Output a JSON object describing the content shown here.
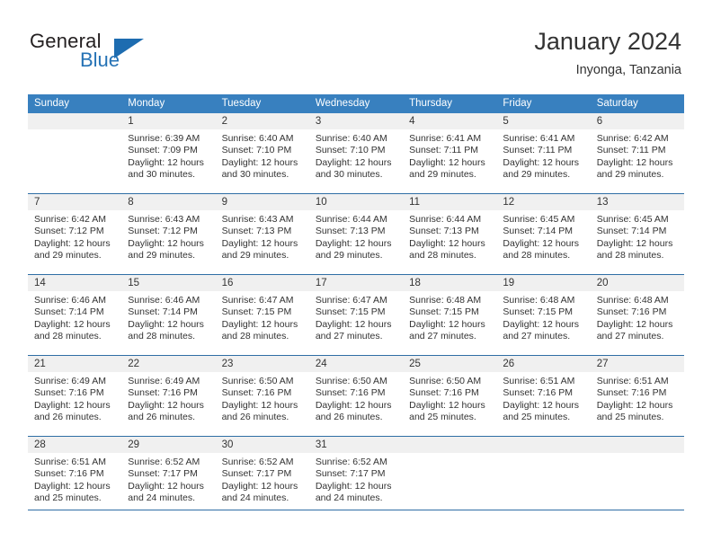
{
  "brand": {
    "name_part1": "General",
    "name_part2": "Blue",
    "triangle_color": "#1d6cb0",
    "blue_color": "#2572b5"
  },
  "header": {
    "title": "January 2024",
    "subtitle": "Inyonga, Tanzania"
  },
  "theme": {
    "header_bar_color": "#3880bf",
    "row_divider_color": "#2f6ea5",
    "day_band_color": "#f0f0f0",
    "text_color": "#333333"
  },
  "weekdays": [
    "Sunday",
    "Monday",
    "Tuesday",
    "Wednesday",
    "Thursday",
    "Friday",
    "Saturday"
  ],
  "weeks": [
    [
      {
        "day": "",
        "sunrise": "",
        "sunset": "",
        "daylight_line1": "",
        "daylight_line2": ""
      },
      {
        "day": "1",
        "sunrise": "Sunrise: 6:39 AM",
        "sunset": "Sunset: 7:09 PM",
        "daylight_line1": "Daylight: 12 hours",
        "daylight_line2": "and 30 minutes."
      },
      {
        "day": "2",
        "sunrise": "Sunrise: 6:40 AM",
        "sunset": "Sunset: 7:10 PM",
        "daylight_line1": "Daylight: 12 hours",
        "daylight_line2": "and 30 minutes."
      },
      {
        "day": "3",
        "sunrise": "Sunrise: 6:40 AM",
        "sunset": "Sunset: 7:10 PM",
        "daylight_line1": "Daylight: 12 hours",
        "daylight_line2": "and 30 minutes."
      },
      {
        "day": "4",
        "sunrise": "Sunrise: 6:41 AM",
        "sunset": "Sunset: 7:11 PM",
        "daylight_line1": "Daylight: 12 hours",
        "daylight_line2": "and 29 minutes."
      },
      {
        "day": "5",
        "sunrise": "Sunrise: 6:41 AM",
        "sunset": "Sunset: 7:11 PM",
        "daylight_line1": "Daylight: 12 hours",
        "daylight_line2": "and 29 minutes."
      },
      {
        "day": "6",
        "sunrise": "Sunrise: 6:42 AM",
        "sunset": "Sunset: 7:11 PM",
        "daylight_line1": "Daylight: 12 hours",
        "daylight_line2": "and 29 minutes."
      }
    ],
    [
      {
        "day": "7",
        "sunrise": "Sunrise: 6:42 AM",
        "sunset": "Sunset: 7:12 PM",
        "daylight_line1": "Daylight: 12 hours",
        "daylight_line2": "and 29 minutes."
      },
      {
        "day": "8",
        "sunrise": "Sunrise: 6:43 AM",
        "sunset": "Sunset: 7:12 PM",
        "daylight_line1": "Daylight: 12 hours",
        "daylight_line2": "and 29 minutes."
      },
      {
        "day": "9",
        "sunrise": "Sunrise: 6:43 AM",
        "sunset": "Sunset: 7:13 PM",
        "daylight_line1": "Daylight: 12 hours",
        "daylight_line2": "and 29 minutes."
      },
      {
        "day": "10",
        "sunrise": "Sunrise: 6:44 AM",
        "sunset": "Sunset: 7:13 PM",
        "daylight_line1": "Daylight: 12 hours",
        "daylight_line2": "and 29 minutes."
      },
      {
        "day": "11",
        "sunrise": "Sunrise: 6:44 AM",
        "sunset": "Sunset: 7:13 PM",
        "daylight_line1": "Daylight: 12 hours",
        "daylight_line2": "and 28 minutes."
      },
      {
        "day": "12",
        "sunrise": "Sunrise: 6:45 AM",
        "sunset": "Sunset: 7:14 PM",
        "daylight_line1": "Daylight: 12 hours",
        "daylight_line2": "and 28 minutes."
      },
      {
        "day": "13",
        "sunrise": "Sunrise: 6:45 AM",
        "sunset": "Sunset: 7:14 PM",
        "daylight_line1": "Daylight: 12 hours",
        "daylight_line2": "and 28 minutes."
      }
    ],
    [
      {
        "day": "14",
        "sunrise": "Sunrise: 6:46 AM",
        "sunset": "Sunset: 7:14 PM",
        "daylight_line1": "Daylight: 12 hours",
        "daylight_line2": "and 28 minutes."
      },
      {
        "day": "15",
        "sunrise": "Sunrise: 6:46 AM",
        "sunset": "Sunset: 7:14 PM",
        "daylight_line1": "Daylight: 12 hours",
        "daylight_line2": "and 28 minutes."
      },
      {
        "day": "16",
        "sunrise": "Sunrise: 6:47 AM",
        "sunset": "Sunset: 7:15 PM",
        "daylight_line1": "Daylight: 12 hours",
        "daylight_line2": "and 28 minutes."
      },
      {
        "day": "17",
        "sunrise": "Sunrise: 6:47 AM",
        "sunset": "Sunset: 7:15 PM",
        "daylight_line1": "Daylight: 12 hours",
        "daylight_line2": "and 27 minutes."
      },
      {
        "day": "18",
        "sunrise": "Sunrise: 6:48 AM",
        "sunset": "Sunset: 7:15 PM",
        "daylight_line1": "Daylight: 12 hours",
        "daylight_line2": "and 27 minutes."
      },
      {
        "day": "19",
        "sunrise": "Sunrise: 6:48 AM",
        "sunset": "Sunset: 7:15 PM",
        "daylight_line1": "Daylight: 12 hours",
        "daylight_line2": "and 27 minutes."
      },
      {
        "day": "20",
        "sunrise": "Sunrise: 6:48 AM",
        "sunset": "Sunset: 7:16 PM",
        "daylight_line1": "Daylight: 12 hours",
        "daylight_line2": "and 27 minutes."
      }
    ],
    [
      {
        "day": "21",
        "sunrise": "Sunrise: 6:49 AM",
        "sunset": "Sunset: 7:16 PM",
        "daylight_line1": "Daylight: 12 hours",
        "daylight_line2": "and 26 minutes."
      },
      {
        "day": "22",
        "sunrise": "Sunrise: 6:49 AM",
        "sunset": "Sunset: 7:16 PM",
        "daylight_line1": "Daylight: 12 hours",
        "daylight_line2": "and 26 minutes."
      },
      {
        "day": "23",
        "sunrise": "Sunrise: 6:50 AM",
        "sunset": "Sunset: 7:16 PM",
        "daylight_line1": "Daylight: 12 hours",
        "daylight_line2": "and 26 minutes."
      },
      {
        "day": "24",
        "sunrise": "Sunrise: 6:50 AM",
        "sunset": "Sunset: 7:16 PM",
        "daylight_line1": "Daylight: 12 hours",
        "daylight_line2": "and 26 minutes."
      },
      {
        "day": "25",
        "sunrise": "Sunrise: 6:50 AM",
        "sunset": "Sunset: 7:16 PM",
        "daylight_line1": "Daylight: 12 hours",
        "daylight_line2": "and 25 minutes."
      },
      {
        "day": "26",
        "sunrise": "Sunrise: 6:51 AM",
        "sunset": "Sunset: 7:16 PM",
        "daylight_line1": "Daylight: 12 hours",
        "daylight_line2": "and 25 minutes."
      },
      {
        "day": "27",
        "sunrise": "Sunrise: 6:51 AM",
        "sunset": "Sunset: 7:16 PM",
        "daylight_line1": "Daylight: 12 hours",
        "daylight_line2": "and 25 minutes."
      }
    ],
    [
      {
        "day": "28",
        "sunrise": "Sunrise: 6:51 AM",
        "sunset": "Sunset: 7:16 PM",
        "daylight_line1": "Daylight: 12 hours",
        "daylight_line2": "and 25 minutes."
      },
      {
        "day": "29",
        "sunrise": "Sunrise: 6:52 AM",
        "sunset": "Sunset: 7:17 PM",
        "daylight_line1": "Daylight: 12 hours",
        "daylight_line2": "and 24 minutes."
      },
      {
        "day": "30",
        "sunrise": "Sunrise: 6:52 AM",
        "sunset": "Sunset: 7:17 PM",
        "daylight_line1": "Daylight: 12 hours",
        "daylight_line2": "and 24 minutes."
      },
      {
        "day": "31",
        "sunrise": "Sunrise: 6:52 AM",
        "sunset": "Sunset: 7:17 PM",
        "daylight_line1": "Daylight: 12 hours",
        "daylight_line2": "and 24 minutes."
      },
      {
        "day": "",
        "sunrise": "",
        "sunset": "",
        "daylight_line1": "",
        "daylight_line2": ""
      },
      {
        "day": "",
        "sunrise": "",
        "sunset": "",
        "daylight_line1": "",
        "daylight_line2": ""
      },
      {
        "day": "",
        "sunrise": "",
        "sunset": "",
        "daylight_line1": "",
        "daylight_line2": ""
      }
    ]
  ]
}
